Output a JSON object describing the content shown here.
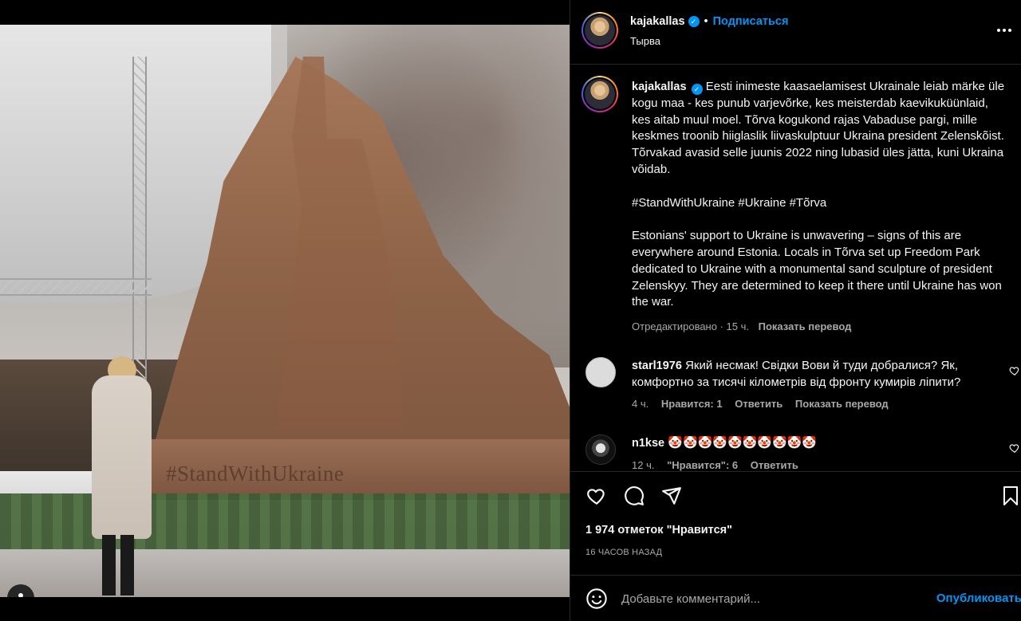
{
  "post": {
    "author": "kajakallas",
    "follow_label": "Подписаться",
    "separator": "•",
    "location": "Тырва",
    "photo_caption": "#StandWithUkraine"
  },
  "caption": {
    "author": "kajakallas",
    "paragraph_1": "Eesti inimeste kaasaelamisest Ukrainale leiab märke üle kogu maa - kes punub varjevõrke, kes meisterdab kaevikuküünlaid, kes aitab muul moel. Tõrva kogukond rajas Vabaduse pargi, mille keskmes troonib hiiglaslik liivaskulptuur Ukraina president Zelenskõist. Tõrvakad avasid selle juunis 2022 ning lubasid üles jätta, kuni Ukraina võidab.",
    "hashtags": "#StandWithUkraine #Ukraine #Tõrva",
    "paragraph_2": "Estonians' support to Ukraine is unwavering – signs of this are everywhere around Estonia. Locals in Tõrva set up Freedom Park dedicated to Ukraine with a monumental sand sculpture of president Zelenskyy. They are determined to keep it there until Ukraine has won the war.",
    "edited": "Отредактировано · 15 ч.",
    "translate": "Показать перевод"
  },
  "comments": [
    {
      "user": "starl1976",
      "text": "Який несмак! Свідки Вови й туди добралися? Як, комфортно за тисячі кілометрів від фронту кумирів ліпити?",
      "time": "4 ч.",
      "likes": "Нравится: 1",
      "reply": "Ответить",
      "translate": "Показать перевод"
    },
    {
      "user": "n1kse",
      "text": "🤡🤡🤡🤡🤡🤡🤡🤡🤡🤡",
      "time": "12 ч.",
      "likes": "\"Нравится\": 6",
      "reply": "Ответить"
    }
  ],
  "actions": {
    "likes_count": "1 974 отметок \"Нравится\"",
    "time_ago": "16 ЧАСОВ НАЗАД"
  },
  "comment_box": {
    "placeholder": "Добавьте комментарий...",
    "publish_label": "Опубликовать"
  },
  "colors": {
    "accent": "#0095f6",
    "background": "#000000",
    "muted_text": "#a8a8a8",
    "divider": "#262626"
  },
  "icons": [
    "user-tag-icon",
    "verified-badge-icon",
    "more-options-icon",
    "heart-icon",
    "comment-icon",
    "share-icon",
    "bookmark-icon",
    "emoji-icon"
  ]
}
